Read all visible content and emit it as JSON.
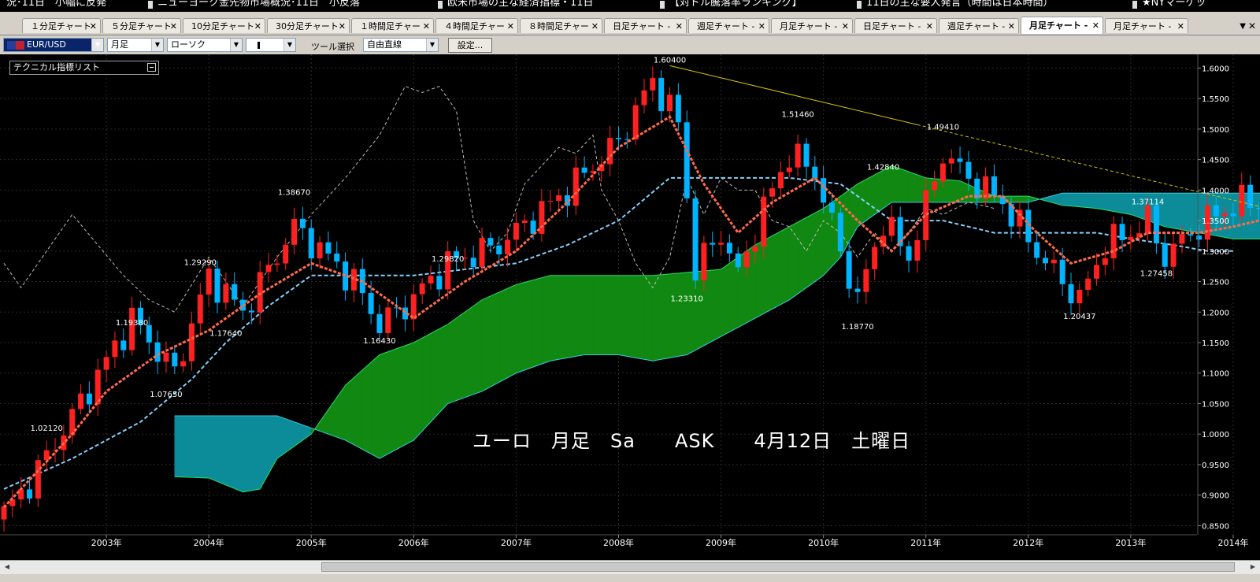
{
  "ticker": [
    {
      "text": "況･11日　小幅に反発",
      "bar": false
    },
    {
      "text": "ニューヨーク金先物市場概況･11日　小反落",
      "bar": true
    },
    {
      "text": "欧米市場の主な経済指標・11日",
      "bar": true
    },
    {
      "text": "【対ドル騰落率ランキング】",
      "bar": true
    },
    {
      "text": "11日の主な要人発言（時間は日本時間）",
      "bar": true
    },
    {
      "text": "★NYマーケッ",
      "bar": true
    }
  ],
  "tabs": [
    {
      "label": "１分足チャート",
      "active": false
    },
    {
      "label": "５分足チャート",
      "active": false
    },
    {
      "label": "10分足チャート",
      "active": false
    },
    {
      "label": "30分足チャート",
      "active": false
    },
    {
      "label": "１時間足チャー",
      "active": false
    },
    {
      "label": "４時間足チャー",
      "active": false
    },
    {
      "label": "８時間足チャー",
      "active": false
    },
    {
      "label": "日足チャート -",
      "active": false
    },
    {
      "label": "週足チャート -",
      "active": false
    },
    {
      "label": "月足チャート -",
      "active": false
    },
    {
      "label": "日足チャート -",
      "active": false
    },
    {
      "label": "週足チャート -",
      "active": false
    },
    {
      "label": "月足チャート -",
      "active": true
    },
    {
      "label": "月足チャート -",
      "active": false
    }
  ],
  "toolbar": {
    "symbol": "EUR/USD",
    "period": "月足",
    "chart_style": "ローソク",
    "candle_icon": "candle-icon",
    "tool_label": "ツール選択",
    "tool": "自由直線",
    "settings": "設定..."
  },
  "indicator_panel": {
    "title": "テクニカル指標リスト"
  },
  "caption": "ユーロ　月足　Sa　　ASK　　4月12日　土曜日",
  "colors": {
    "background": "#000000",
    "bull_candle": "#ff2020",
    "bear_candle": "#00b4ff",
    "conversion_line": "#ff6a4a",
    "base_line": "#87cefa",
    "lagging_span": "#bbbbbb",
    "cloud_bullish": "#118811",
    "cloud_bearish": "#0c8c99",
    "trendline": "#d8c800"
  },
  "chart_data": {
    "type": "candlestick",
    "instrument": "EUR/USD",
    "timeframe": "月足",
    "y_ticks": [
      "1.6000",
      "1.5500",
      "1.5000",
      "1.4500",
      "1.4000",
      "1.3500",
      "1.3000",
      "1.2500",
      "1.2000",
      "1.1500",
      "1.1000",
      "1.0500",
      "1.0000",
      "0.9500",
      "0.9000",
      "0.8500"
    ],
    "ylim": [
      0.835,
      1.6225
    ],
    "x_ticks": [
      "2003年",
      "2004年",
      "2005年",
      "2006年",
      "2007年",
      "2008年",
      "2009年",
      "2010年",
      "2011年",
      "2012年",
      "2013年",
      "2014年"
    ],
    "x_tick_index": [
      12,
      24,
      36,
      48,
      60,
      72,
      84,
      96,
      108,
      120,
      132,
      144
    ],
    "annotations": [
      {
        "label": "1.60400",
        "i": 78,
        "price": 1.604
      },
      {
        "label": "1.51460",
        "i": 93,
        "price": 1.5146
      },
      {
        "label": "1.49410",
        "i": 110,
        "price": 1.4941
      },
      {
        "label": "1.42840",
        "i": 103,
        "price": 1.4284
      },
      {
        "label": "1.38670",
        "i": 34,
        "price": 1.3867
      },
      {
        "label": "1.37114",
        "i": 134,
        "price": 1.37114
      },
      {
        "label": "1.29290",
        "i": 23,
        "price": 1.2929
      },
      {
        "label": "1.29820",
        "i": 52,
        "price": 1.2982
      },
      {
        "label": "1.19380",
        "i": 15,
        "price": 1.1938
      },
      {
        "label": "1.17640",
        "i": 26,
        "price": 1.1764
      },
      {
        "label": "1.16430",
        "i": 44,
        "price": 1.1643
      },
      {
        "label": "1.07650",
        "i": 19,
        "price": 1.0765
      },
      {
        "label": "1.02120",
        "i": 5,
        "price": 1.0212
      },
      {
        "label": "1.23310",
        "i": 80,
        "price": 1.2331
      },
      {
        "label": "1.18770",
        "i": 100,
        "price": 1.1877
      },
      {
        "label": "1.20437",
        "i": 126,
        "price": 1.20437
      },
      {
        "label": "1.27458",
        "i": 135,
        "price": 1.27458
      }
    ],
    "price_anchors": [
      [
        0,
        0.87
      ],
      [
        3,
        0.92
      ],
      [
        6,
        0.985
      ],
      [
        12,
        1.12
      ],
      [
        15,
        1.19
      ],
      [
        20,
        1.1
      ],
      [
        24,
        1.26
      ],
      [
        28,
        1.2
      ],
      [
        34,
        1.34
      ],
      [
        38,
        1.29
      ],
      [
        41,
        1.25
      ],
      [
        44,
        1.18
      ],
      [
        47,
        1.21
      ],
      [
        52,
        1.28
      ],
      [
        58,
        1.31
      ],
      [
        66,
        1.4
      ],
      [
        72,
        1.48
      ],
      [
        76,
        1.58
      ],
      [
        79,
        1.51
      ],
      [
        81,
        1.27
      ],
      [
        84,
        1.33
      ],
      [
        86,
        1.26
      ],
      [
        89,
        1.37
      ],
      [
        92,
        1.46
      ],
      [
        95,
        1.43
      ],
      [
        98,
        1.3
      ],
      [
        100,
        1.22
      ],
      [
        103,
        1.35
      ],
      [
        106,
        1.29
      ],
      [
        110,
        1.46
      ],
      [
        113,
        1.42
      ],
      [
        117,
        1.38
      ],
      [
        121,
        1.3
      ],
      [
        124,
        1.25
      ],
      [
        126,
        1.22
      ],
      [
        129,
        1.31
      ],
      [
        132,
        1.33
      ],
      [
        134,
        1.35
      ],
      [
        136,
        1.29
      ],
      [
        139,
        1.33
      ],
      [
        142,
        1.36
      ],
      [
        145,
        1.38
      ],
      [
        147,
        1.38
      ]
    ],
    "tenkan_anchors": [
      [
        0,
        0.88
      ],
      [
        4,
        0.94
      ],
      [
        8,
        1.0
      ],
      [
        12,
        1.07
      ],
      [
        18,
        1.13
      ],
      [
        24,
        1.17
      ],
      [
        30,
        1.23
      ],
      [
        36,
        1.28
      ],
      [
        42,
        1.25
      ],
      [
        48,
        1.19
      ],
      [
        54,
        1.25
      ],
      [
        60,
        1.3
      ],
      [
        66,
        1.38
      ],
      [
        72,
        1.47
      ],
      [
        78,
        1.52
      ],
      [
        82,
        1.41
      ],
      [
        86,
        1.33
      ],
      [
        90,
        1.38
      ],
      [
        95,
        1.42
      ],
      [
        100,
        1.35
      ],
      [
        104,
        1.3
      ],
      [
        108,
        1.36
      ],
      [
        113,
        1.39
      ],
      [
        117,
        1.39
      ],
      [
        121,
        1.33
      ],
      [
        125,
        1.28
      ],
      [
        130,
        1.3
      ],
      [
        134,
        1.33
      ],
      [
        140,
        1.33
      ],
      [
        144,
        1.34
      ],
      [
        147,
        1.35
      ]
    ],
    "kijun_anchors": [
      [
        0,
        0.91
      ],
      [
        8,
        0.96
      ],
      [
        16,
        1.02
      ],
      [
        22,
        1.09
      ],
      [
        26,
        1.15
      ],
      [
        31,
        1.21
      ],
      [
        36,
        1.26
      ],
      [
        42,
        1.26
      ],
      [
        48,
        1.26
      ],
      [
        54,
        1.27
      ],
      [
        60,
        1.28
      ],
      [
        66,
        1.31
      ],
      [
        72,
        1.35
      ],
      [
        78,
        1.42
      ],
      [
        84,
        1.42
      ],
      [
        92,
        1.42
      ],
      [
        98,
        1.41
      ],
      [
        104,
        1.35
      ],
      [
        110,
        1.35
      ],
      [
        116,
        1.33
      ],
      [
        122,
        1.33
      ],
      [
        128,
        1.33
      ],
      [
        132,
        1.32
      ],
      [
        137,
        1.31
      ],
      [
        141,
        1.3
      ],
      [
        144,
        1.3
      ]
    ],
    "chikou_anchors": [
      [
        0,
        1.28
      ],
      [
        2,
        1.24
      ],
      [
        5,
        1.3
      ],
      [
        8,
        1.36
      ],
      [
        11,
        1.31
      ],
      [
        14,
        1.26
      ],
      [
        17,
        1.22
      ],
      [
        20,
        1.2
      ],
      [
        24,
        1.29
      ],
      [
        28,
        1.21
      ],
      [
        32,
        1.29
      ],
      [
        36,
        1.36
      ],
      [
        40,
        1.42
      ],
      [
        44,
        1.49
      ],
      [
        47,
        1.57
      ],
      [
        49,
        1.56
      ],
      [
        51,
        1.57
      ],
      [
        53,
        1.53
      ],
      [
        55,
        1.35
      ],
      [
        57,
        1.3
      ],
      [
        59,
        1.33
      ],
      [
        61,
        1.41
      ],
      [
        63,
        1.44
      ],
      [
        65,
        1.47
      ],
      [
        67,
        1.46
      ],
      [
        69,
        1.49
      ],
      [
        70,
        1.4
      ],
      [
        72,
        1.35
      ],
      [
        74,
        1.28
      ],
      [
        76,
        1.24
      ],
      [
        78,
        1.29
      ],
      [
        80,
        1.42
      ],
      [
        82,
        1.36
      ],
      [
        84,
        1.42
      ],
      [
        86,
        1.4
      ],
      [
        88,
        1.4
      ],
      [
        90,
        1.35
      ],
      [
        92,
        1.34
      ],
      [
        94,
        1.3
      ],
      [
        96,
        1.35
      ],
      [
        98,
        1.33
      ],
      [
        100,
        1.29
      ],
      [
        102,
        1.33
      ],
      [
        104,
        1.3
      ],
      [
        106,
        1.33
      ],
      [
        108,
        1.37
      ],
      [
        110,
        1.36
      ],
      [
        113,
        1.38
      ],
      [
        116,
        1.37
      ]
    ],
    "span_a_anchors": [
      [
        20,
        0.93
      ],
      [
        24,
        0.928
      ],
      [
        28,
        0.905
      ],
      [
        30,
        0.91
      ],
      [
        32,
        0.96
      ],
      [
        36,
        1.0
      ],
      [
        40,
        1.08
      ],
      [
        44,
        1.13
      ],
      [
        48,
        1.15
      ],
      [
        52,
        1.18
      ],
      [
        56,
        1.22
      ],
      [
        60,
        1.245
      ],
      [
        64,
        1.26
      ],
      [
        68,
        1.26
      ],
      [
        72,
        1.26
      ],
      [
        76,
        1.26
      ],
      [
        80,
        1.265
      ],
      [
        84,
        1.27
      ],
      [
        88,
        1.31
      ],
      [
        92,
        1.34
      ],
      [
        96,
        1.37
      ],
      [
        98,
        1.39
      ],
      [
        100,
        1.41
      ],
      [
        104,
        1.44
      ],
      [
        108,
        1.42
      ],
      [
        112,
        1.415
      ],
      [
        116,
        1.39
      ],
      [
        120,
        1.39
      ],
      [
        124,
        1.375
      ],
      [
        128,
        1.37
      ],
      [
        132,
        1.36
      ],
      [
        136,
        1.34
      ],
      [
        140,
        1.33
      ],
      [
        144,
        1.32
      ],
      [
        148,
        1.32
      ],
      [
        152,
        1.32
      ],
      [
        156,
        1.32
      ],
      [
        160,
        1.31
      ],
      [
        165,
        1.31
      ],
      [
        168,
        1.33
      ]
    ],
    "span_b_anchors": [
      [
        20,
        1.03
      ],
      [
        24,
        1.03
      ],
      [
        28,
        1.03
      ],
      [
        32,
        1.03
      ],
      [
        36,
        1.01
      ],
      [
        40,
        0.99
      ],
      [
        44,
        0.96
      ],
      [
        48,
        0.99
      ],
      [
        52,
        1.05
      ],
      [
        56,
        1.07
      ],
      [
        60,
        1.1
      ],
      [
        64,
        1.12
      ],
      [
        68,
        1.13
      ],
      [
        72,
        1.13
      ],
      [
        76,
        1.12
      ],
      [
        80,
        1.13
      ],
      [
        84,
        1.16
      ],
      [
        88,
        1.19
      ],
      [
        92,
        1.22
      ],
      [
        96,
        1.26
      ],
      [
        98,
        1.29
      ],
      [
        100,
        1.34
      ],
      [
        104,
        1.38
      ],
      [
        108,
        1.38
      ],
      [
        112,
        1.38
      ],
      [
        116,
        1.38
      ],
      [
        120,
        1.38
      ],
      [
        124,
        1.395
      ],
      [
        128,
        1.395
      ],
      [
        132,
        1.395
      ],
      [
        136,
        1.395
      ],
      [
        140,
        1.395
      ],
      [
        144,
        1.395
      ],
      [
        148,
        1.395
      ],
      [
        152,
        1.395
      ],
      [
        156,
        1.35
      ],
      [
        160,
        1.35
      ],
      [
        165,
        1.35
      ],
      [
        168,
        1.34
      ]
    ],
    "trendline": {
      "from": {
        "i": 78,
        "price": 1.604
      },
      "to": {
        "i": 169,
        "price": 1.3
      }
    }
  }
}
